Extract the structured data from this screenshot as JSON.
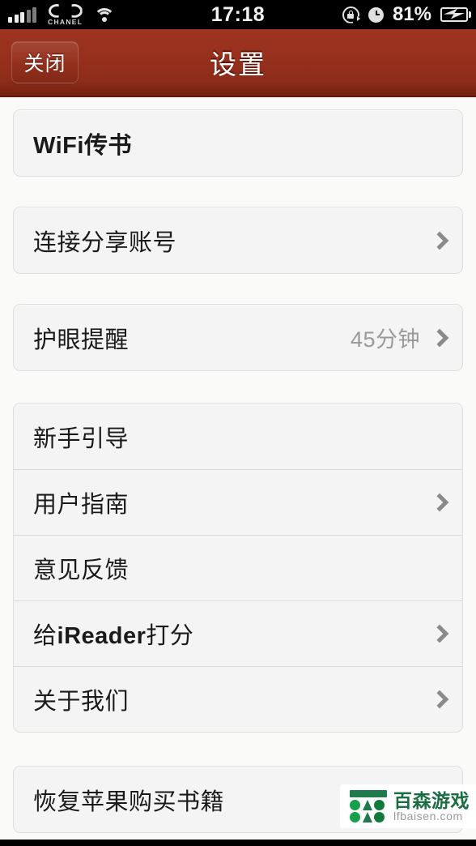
{
  "status_bar": {
    "carrier": "CHANEL",
    "time": "17:18",
    "battery_percent": "81%",
    "icons": [
      "signal-bars-icon",
      "chanel-logo-icon",
      "wifi-icon",
      "rotation-lock-icon",
      "alarm-clock-icon",
      "battery-charging-icon"
    ]
  },
  "navbar": {
    "close_label": "关闭",
    "title": "设置",
    "background_color": "#96301d"
  },
  "groups": [
    {
      "rows": [
        {
          "label": "WiFi传书",
          "bold": true,
          "value": "",
          "chevron": false
        }
      ]
    },
    {
      "rows": [
        {
          "label": "连接分享账号",
          "bold": false,
          "value": "",
          "chevron": true
        }
      ]
    },
    {
      "rows": [
        {
          "label": "护眼提醒",
          "bold": false,
          "value": "45分钟",
          "chevron": true
        }
      ]
    },
    {
      "rows": [
        {
          "label": "新手引导",
          "bold": false,
          "value": "",
          "chevron": false
        },
        {
          "label": "用户指南",
          "bold": false,
          "value": "",
          "chevron": true
        },
        {
          "label": "意见反馈",
          "bold": false,
          "value": "",
          "chevron": false
        },
        {
          "label": "给iReader打分",
          "bold": false,
          "value": "",
          "chevron": true,
          "emphasis": "iReader"
        },
        {
          "label": "关于我们",
          "bold": false,
          "value": "",
          "chevron": true
        }
      ]
    },
    {
      "rows": [
        {
          "label": "恢复苹果购买书籍",
          "bold": false,
          "value": "",
          "chevron": false
        }
      ]
    }
  ],
  "watermark": {
    "title": "百森游戏",
    "subtitle": "lfbaisen.com",
    "color": "#1b6e41"
  }
}
